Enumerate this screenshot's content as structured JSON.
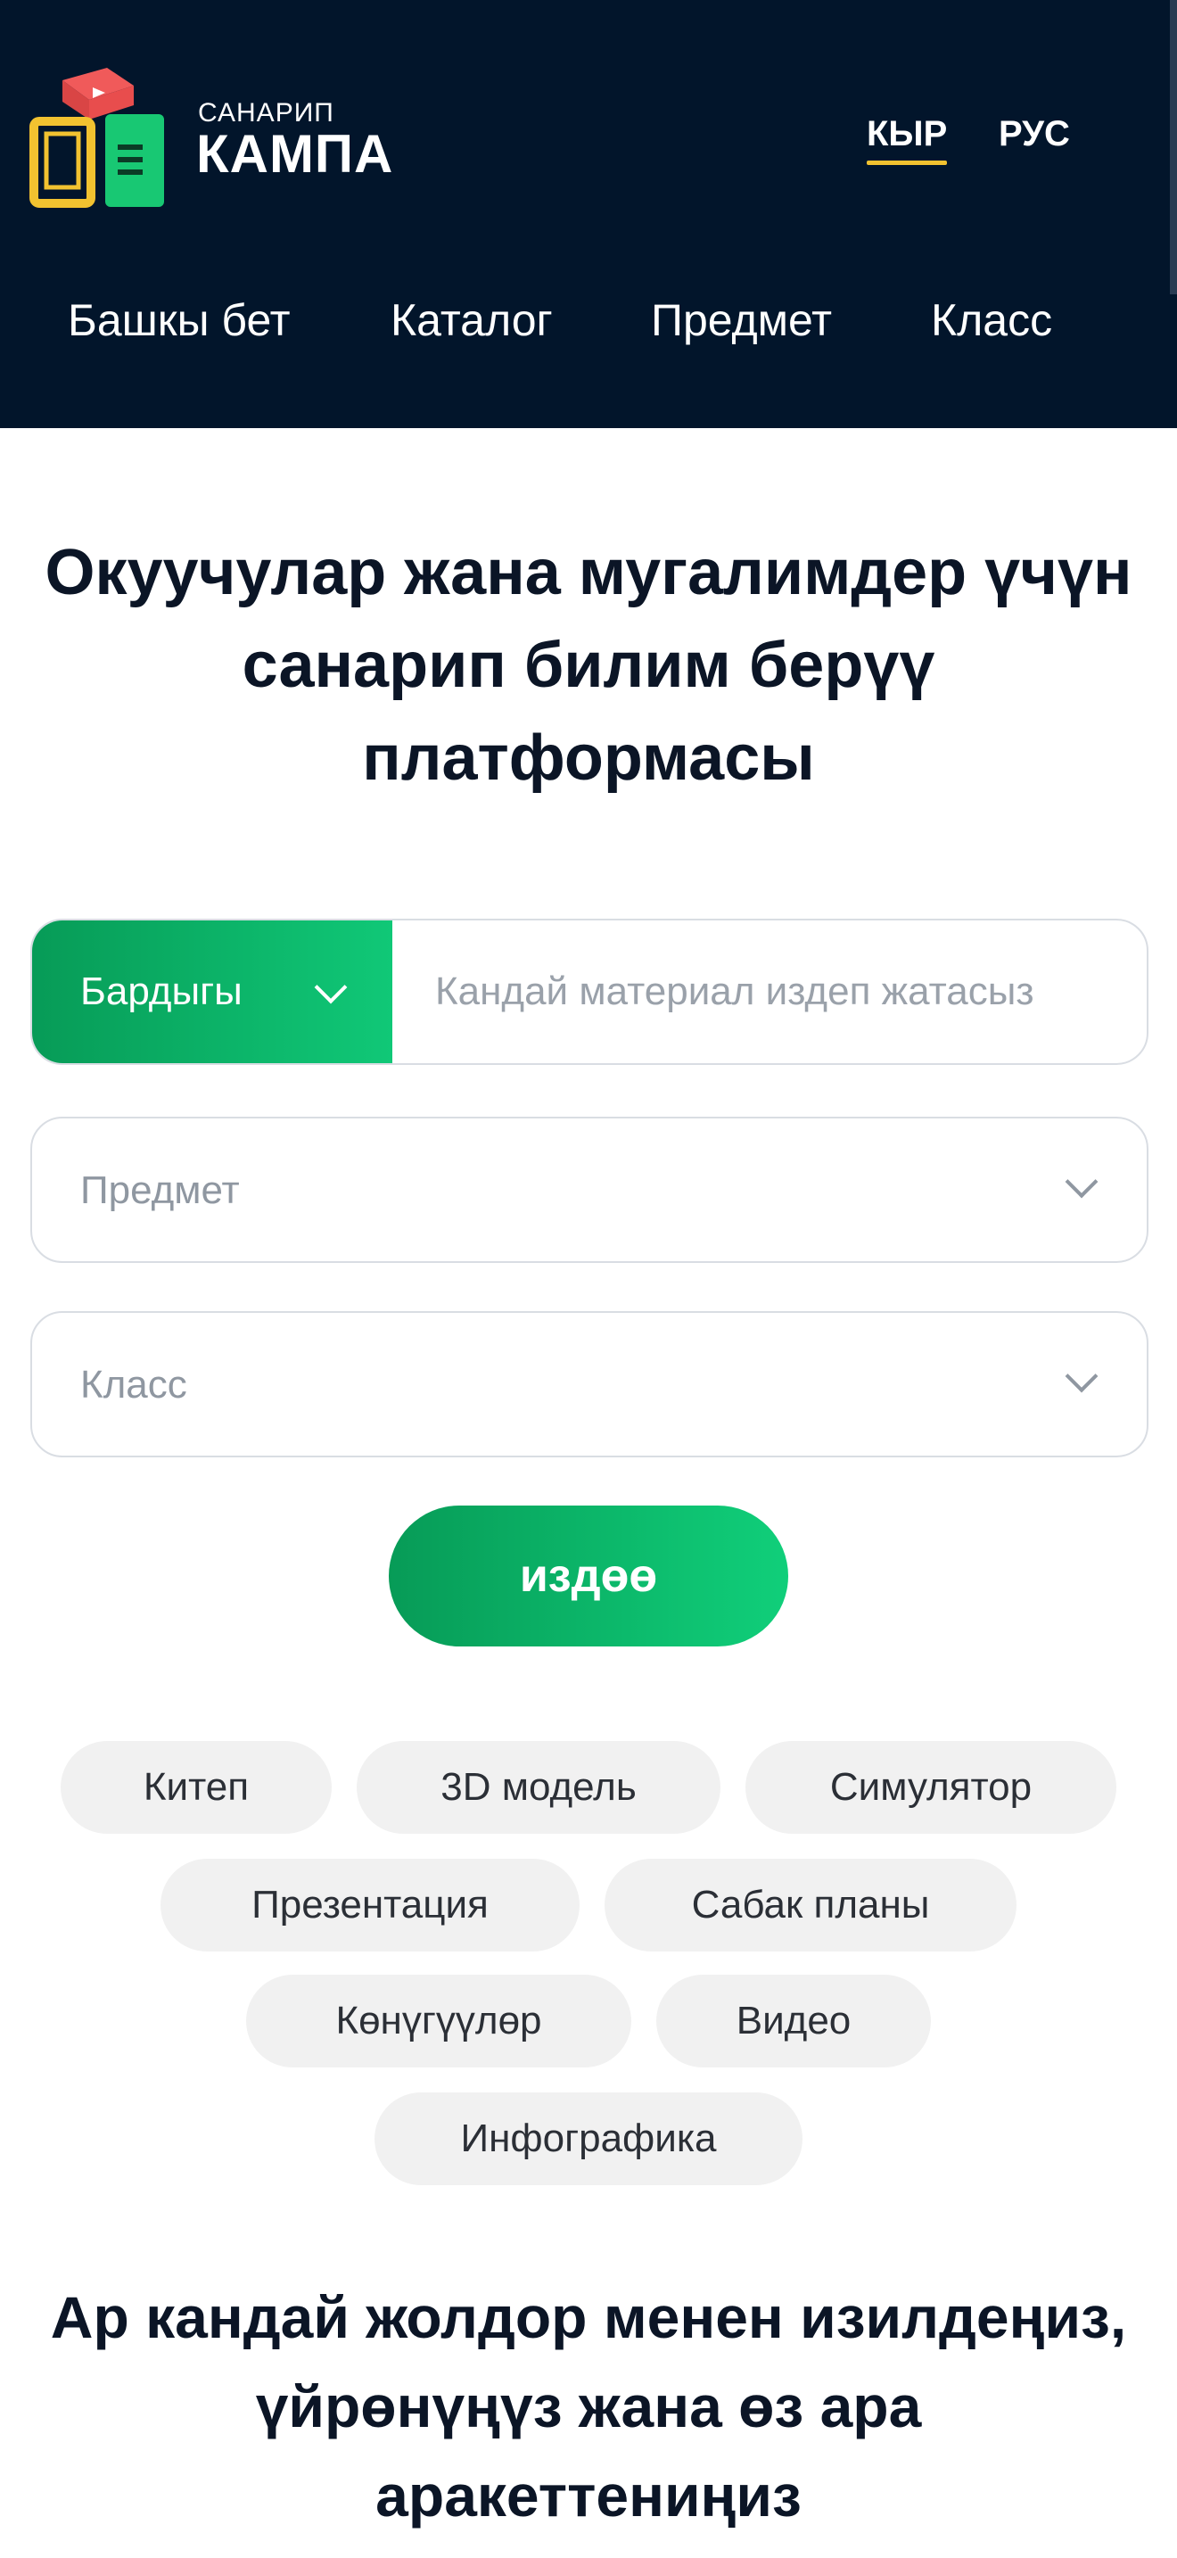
{
  "header": {
    "brand_small": "САНАРИП",
    "brand_big": "КАМПА",
    "languages": [
      {
        "label": "КЫР",
        "active": true
      },
      {
        "label": "РУС",
        "active": false
      }
    ],
    "nav": [
      "Башкы бет",
      "Каталог",
      "Предмет",
      "Класс"
    ],
    "accent_color": "#f2c230",
    "background_color": "#02152b"
  },
  "hero": {
    "title": "Окуучулар жана мугалимдер үчүн санарип билим берүү платформасы"
  },
  "search": {
    "category_selected": "Бардыгы",
    "input_placeholder": "Кандай материал издеп жатасыз",
    "subject_placeholder": "Предмет",
    "class_placeholder": "Класс",
    "button_label": "издөө",
    "brand_color": "#0fbf74"
  },
  "chips": [
    "Китеп",
    "3D модель",
    "Симулятор",
    "Презентация",
    "Сабак планы",
    "Көнүгүүлөр",
    "Видео",
    "Инфографика"
  ],
  "section": {
    "title": "Ар кандай жолдор менен изилдеңиз, үйрөнүңүз жана өз ара аракеттениңиз"
  },
  "icons": [
    "logo-icon",
    "chevron-down-icon"
  ]
}
